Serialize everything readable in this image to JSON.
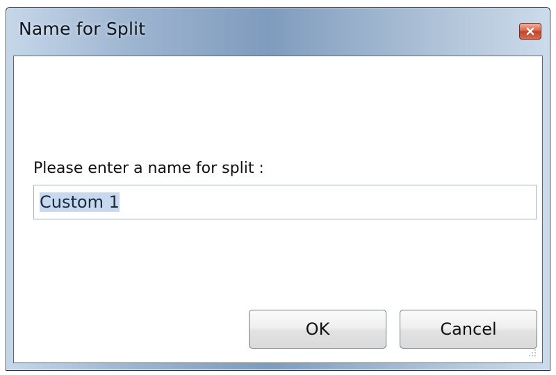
{
  "window": {
    "title": "Name for Split"
  },
  "dialog": {
    "prompt": "Please enter a name for split :",
    "input_value": "Custom 1"
  },
  "buttons": {
    "ok": "OK",
    "cancel": "Cancel"
  },
  "icons": {
    "close": "close-icon",
    "resize_grip": "resize-grip-icon"
  },
  "colors": {
    "close_button": "#d9684e",
    "selection_highlight": "#c7d8ef",
    "input_border": "#9fb4c7"
  }
}
